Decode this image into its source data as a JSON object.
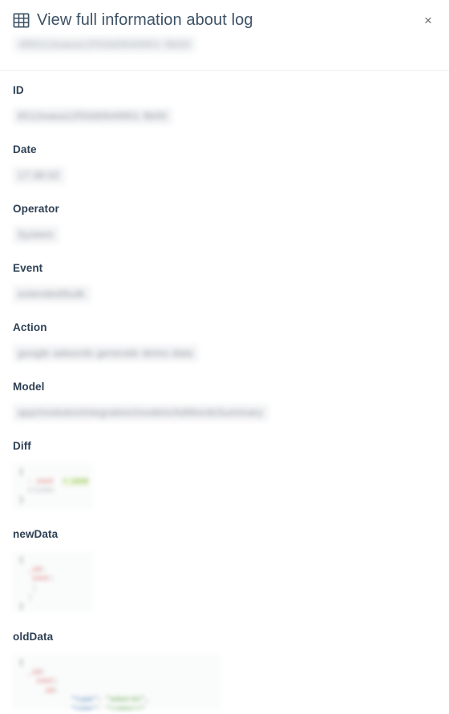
{
  "header": {
    "icon": "table-grid-icon",
    "title": "View full information about log",
    "subtitle": "4fb512eaea12f33d0649901 9b00",
    "close_label": "×"
  },
  "colors": {
    "title": "#3e5266",
    "label": "#2e4054",
    "divider": "#eceff1",
    "code_background": "#fafbfb",
    "diff_added": "#7fb23c",
    "diff_removed": "#d44a4a",
    "json_key": "#3d72b4",
    "json_string": "#4f9d3a"
  },
  "fields": [
    {
      "id": "id",
      "label": "ID",
      "value": "6512eaea12f33d0649901 9b00",
      "type": "text"
    },
    {
      "id": "date",
      "label": "Date",
      "value": "17:38:02",
      "type": "text"
    },
    {
      "id": "operator",
      "label": "Operator",
      "value": "System",
      "type": "text"
    },
    {
      "id": "event",
      "label": "Event",
      "value": "extended/bulk",
      "type": "text"
    },
    {
      "id": "action",
      "label": "Action",
      "value": "google adwords generate demo data",
      "type": "text"
    },
    {
      "id": "model",
      "label": "Model",
      "value": "app/modules/integration/models/AdWordsSummary",
      "type": "text"
    },
    {
      "id": "diff",
      "label": "Diff",
      "type": "code",
      "variant": "diff",
      "lines": [
        [
          {
            "t": "{",
            "c": "tk-punc"
          }
        ],
        [
          {
            "t": "  ",
            "c": "tk-punc"
          },
          {
            "t": "-",
            "c": "tk-del"
          },
          {
            "t": " cost",
            "c": "tk-del"
          },
          {
            "t": "  ",
            "c": "tk-punc"
          },
          {
            "t": "+ 1820",
            "c": "tk-add"
          }
        ],
        [
          {
            "t": "  ",
            "c": "tk-punc"
          },
          {
            "t": "clicks",
            "c": "tk-dim"
          }
        ],
        [
          {
            "t": "}",
            "c": "tk-punc"
          }
        ]
      ]
    },
    {
      "id": "newData",
      "label": "newData",
      "type": "code",
      "variant": "new",
      "lines": [
        [
          {
            "t": "{",
            "c": "tk-punc"
          }
        ],
        [
          {
            "t": "  ",
            "c": "tk-punc"
          },
          {
            "t": "_id",
            "c": "tk-del"
          },
          {
            "t": ":",
            "c": "tk-punc"
          }
        ],
        [
          {
            "t": "   ",
            "c": "tk-punc"
          },
          {
            "t": "cost",
            "c": "tk-del"
          },
          {
            "t": ":",
            "c": "tk-punc"
          }
        ],
        [
          {
            "t": "   ",
            "c": "tk-punc"
          },
          {
            "t": "|",
            "c": "tk-dim"
          }
        ],
        [
          {
            "t": "  ",
            "c": "tk-punc"
          },
          {
            "t": "|",
            "c": "tk-dim"
          }
        ],
        [
          {
            "t": "}",
            "c": "tk-punc"
          }
        ]
      ]
    },
    {
      "id": "oldData",
      "label": "oldData",
      "type": "code",
      "variant": "old",
      "lines": [
        [
          {
            "t": "{",
            "c": "tk-punc"
          }
        ],
        [
          {
            "t": "  ",
            "c": "tk-punc"
          },
          {
            "t": "_id",
            "c": "tk-del"
          },
          {
            "t": ":",
            "c": "tk-punc"
          }
        ],
        [
          {
            "t": "    ",
            "c": "tk-punc"
          },
          {
            "t": "cost",
            "c": "tk-del"
          },
          {
            "t": ":",
            "c": "tk-punc"
          }
        ],
        [
          {
            "t": "      ",
            "c": "tk-punc"
          },
          {
            "t": "id",
            "c": "tk-del"
          },
          {
            "t": ":",
            "c": "tk-punc"
          }
        ],
        [
          {
            "t": "            ",
            "c": "tk-punc"
          },
          {
            "t": "\"type\"",
            "c": "tk-key"
          },
          {
            "t": ": ",
            "c": "tk-punc"
          },
          {
            "t": "\"adwords\"",
            "c": "tk-str"
          },
          {
            "t": ",",
            "c": "tk-punc"
          }
        ],
        [
          {
            "t": "            ",
            "c": "tk-punc"
          },
          {
            "t": "\"name\"",
            "c": "tk-key"
          },
          {
            "t": ": ",
            "c": "tk-punc"
          },
          {
            "t": "\"summary\"",
            "c": "tk-str"
          }
        ]
      ]
    }
  ]
}
